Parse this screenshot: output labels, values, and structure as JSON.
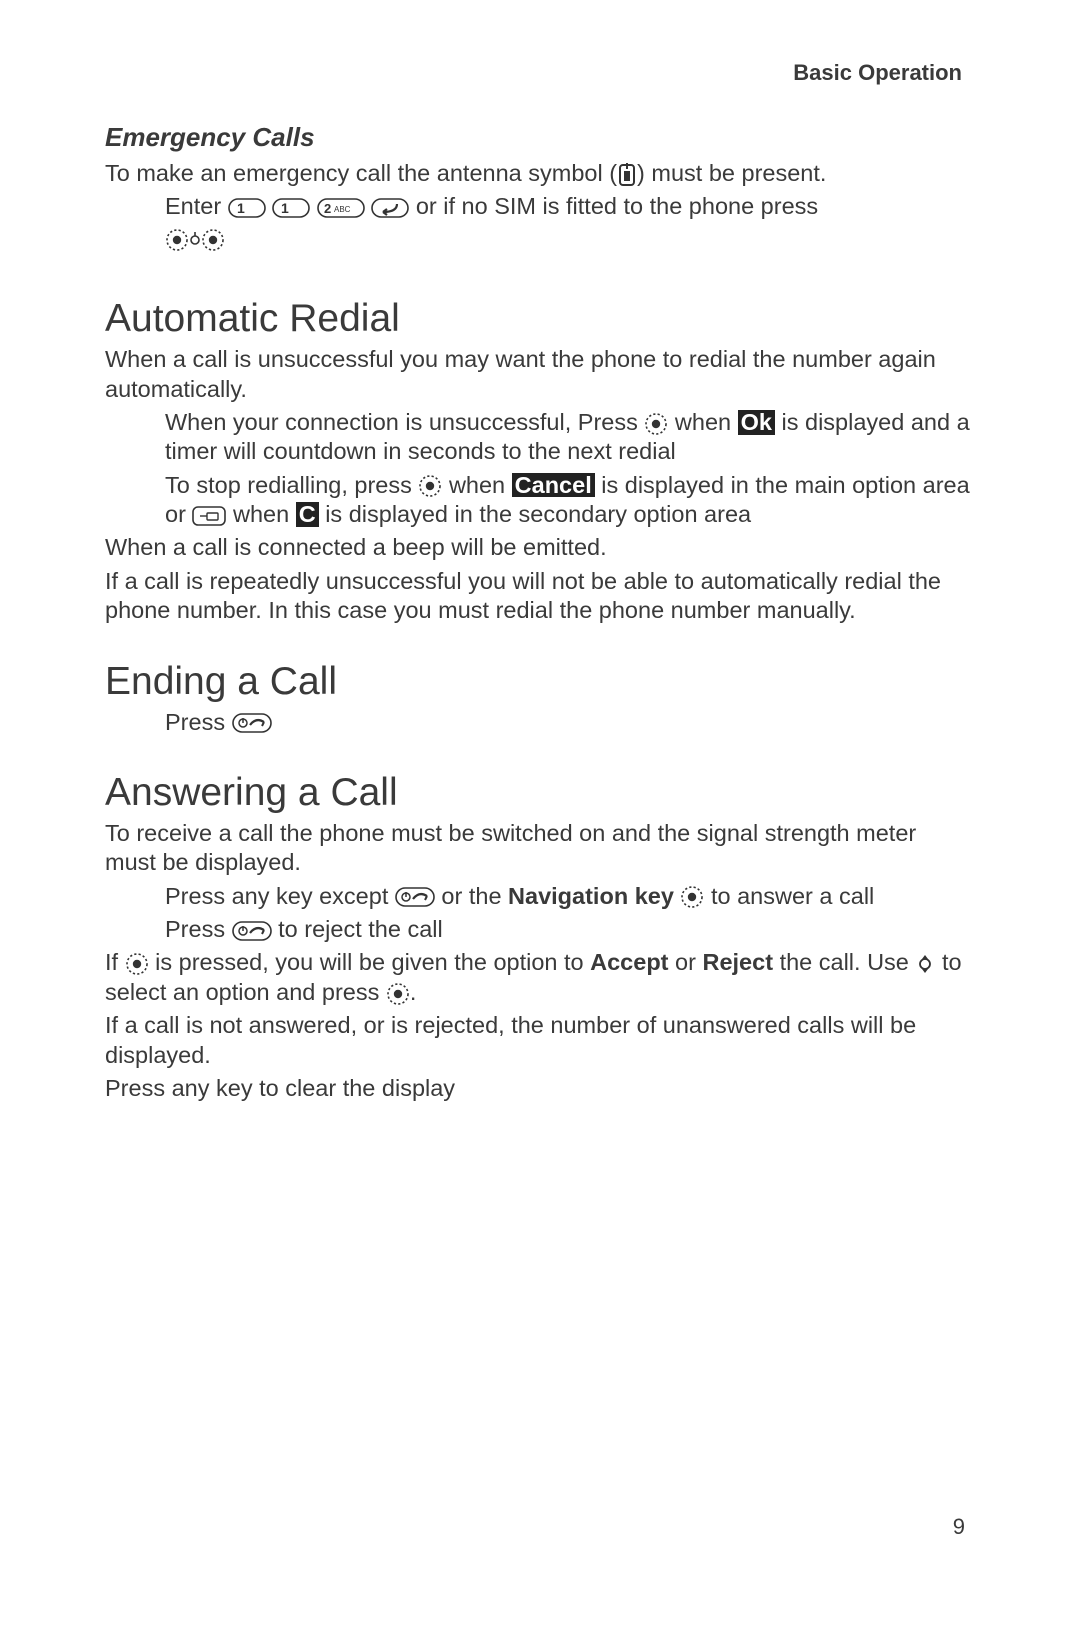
{
  "header": {
    "section": "Basic Operation"
  },
  "emergency": {
    "heading": "Emergency Calls",
    "intro_a": "To make an emergency call the antenna symbol (",
    "intro_b": ") must be present.",
    "enter_a": "Enter ",
    "enter_b": " or if no SIM is fitted to the phone press"
  },
  "redial": {
    "heading": "Automatic Redial",
    "intro": "When a call is unsuccessful you may want the phone to redial the number again automatically.",
    "step1_a": "When your connection is unsuccessful, Press ",
    "step1_b": " when ",
    "step1_ok": "Ok",
    "step1_c": " is displayed and a timer will countdown in seconds to the next redial",
    "step2_a": "To stop redialling, press ",
    "step2_b": " when ",
    "step2_cancel": "Cancel",
    "step2_c": " is displayed in the main option area or ",
    "step2_d": " when ",
    "step2_cicon": "C",
    "step2_e": " is displayed in the secondary option area",
    "after1": "When a call is connected a beep will be emitted.",
    "after2": "If a call is repeatedly unsuccessful you will not be able to automatically redial the phone number. In this case you must redial the phone number manually."
  },
  "end": {
    "heading": "Ending a Call",
    "press": "Press "
  },
  "answer": {
    "heading": "Answering a Call",
    "intro": "To receive a call the phone must be switched on and the signal strength meter must be displayed.",
    "step1_a": "Press any key except ",
    "step1_b": " or the ",
    "step1_nav": "Navigation key",
    "step1_c": "  to answer a call",
    "step2_a": "Press ",
    "step2_b": " to reject the call",
    "ifnav_a": "If ",
    "ifnav_b": " is pressed, you will be given the option to ",
    "ifnav_accept": "Accept",
    "ifnav_c": " or ",
    "ifnav_reject": "Reject",
    "ifnav_d": " the call. Use ",
    "ifnav_e": " to select an option and press ",
    "ifnav_f": ".",
    "after1": "If a call is not answered, or is rejected, the number of unanswered calls will be displayed.",
    "after2": "Press any key to clear the display"
  },
  "page_number": "9"
}
